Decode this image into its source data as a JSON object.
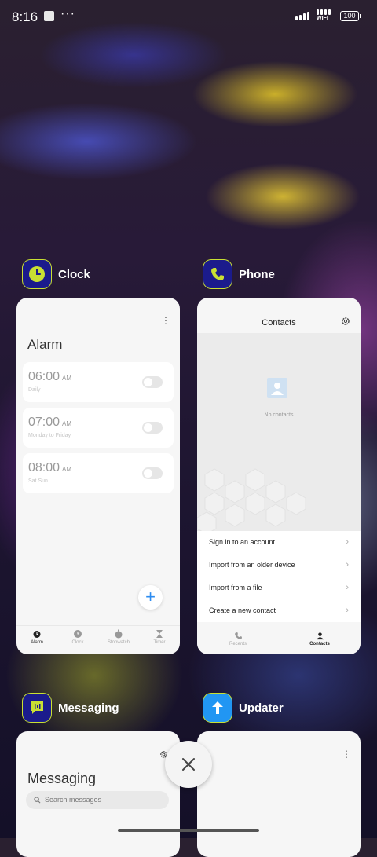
{
  "status_bar": {
    "time": "8:16",
    "more": "···",
    "network_label": "WIFI",
    "battery": "100"
  },
  "apps": {
    "clock": {
      "label": "Clock",
      "screen_title": "Alarm",
      "alarms": [
        {
          "time": "06:00",
          "ampm": "AM",
          "repeat": "Daily"
        },
        {
          "time": "07:00",
          "ampm": "AM",
          "repeat": "Monday to Friday"
        },
        {
          "time": "08:00",
          "ampm": "AM",
          "repeat": "Sat Sun"
        }
      ],
      "add_label": "+",
      "nav": [
        "Alarm",
        "Clock",
        "Stopwatch",
        "Timer"
      ]
    },
    "phone": {
      "label": "Phone",
      "screen_title": "Contacts",
      "empty_text": "No contacts",
      "menu": [
        "Sign in to an account",
        "Import from an older device",
        "Import from a file",
        "Create a new contact"
      ],
      "nav": [
        "Recents",
        "Contacts"
      ]
    },
    "messaging": {
      "label": "Messaging",
      "screen_title": "Messaging",
      "search_placeholder": "Search messages"
    },
    "updater": {
      "label": "Updater"
    }
  },
  "colors": {
    "clock_icon": "#c9e033",
    "icon_bg": "#1b1b8c",
    "updater_icon": "#2196f3",
    "fab": "#2d8cf0"
  }
}
